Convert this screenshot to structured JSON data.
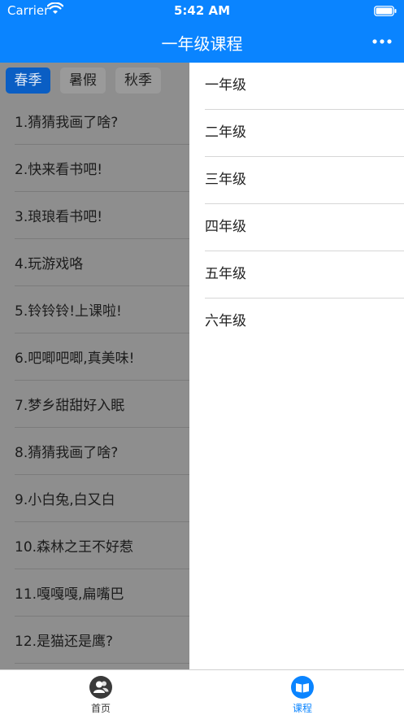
{
  "status_bar": {
    "carrier": "Carrier",
    "time": "5:42 AM"
  },
  "nav": {
    "title": "一年级课程",
    "more_icon": "ellipsis-icon"
  },
  "season_tabs": [
    {
      "label": "春季",
      "active": true
    },
    {
      "label": "暑假",
      "active": false
    },
    {
      "label": "秋季",
      "active": false
    }
  ],
  "lessons": [
    "1.猜猜我画了啥?",
    "2.快来看书吧!",
    "3.琅琅看书吧!",
    "4.玩游戏咯",
    "5.铃铃铃!上课啦!",
    "6.吧唧吧唧,真美味!",
    "7.梦乡甜甜好入眠",
    "8.猜猜我画了啥?",
    "9.小白兔,白又白",
    "10.森林之王不好惹",
    "11.嘎嘎嘎,扁嘴巴",
    "12.是猫还是鹰?"
  ],
  "grades": [
    "一年级",
    "二年级",
    "三年级",
    "四年级",
    "五年级",
    "六年级"
  ],
  "tab_bar": {
    "home_label": "首页",
    "courses_label": "课程",
    "active": "courses"
  },
  "colors": {
    "brand_blue": "#0a84ff",
    "active_tab_blue": "#0a5ec4",
    "inactive_tab_gray": "#3a3a3a"
  }
}
